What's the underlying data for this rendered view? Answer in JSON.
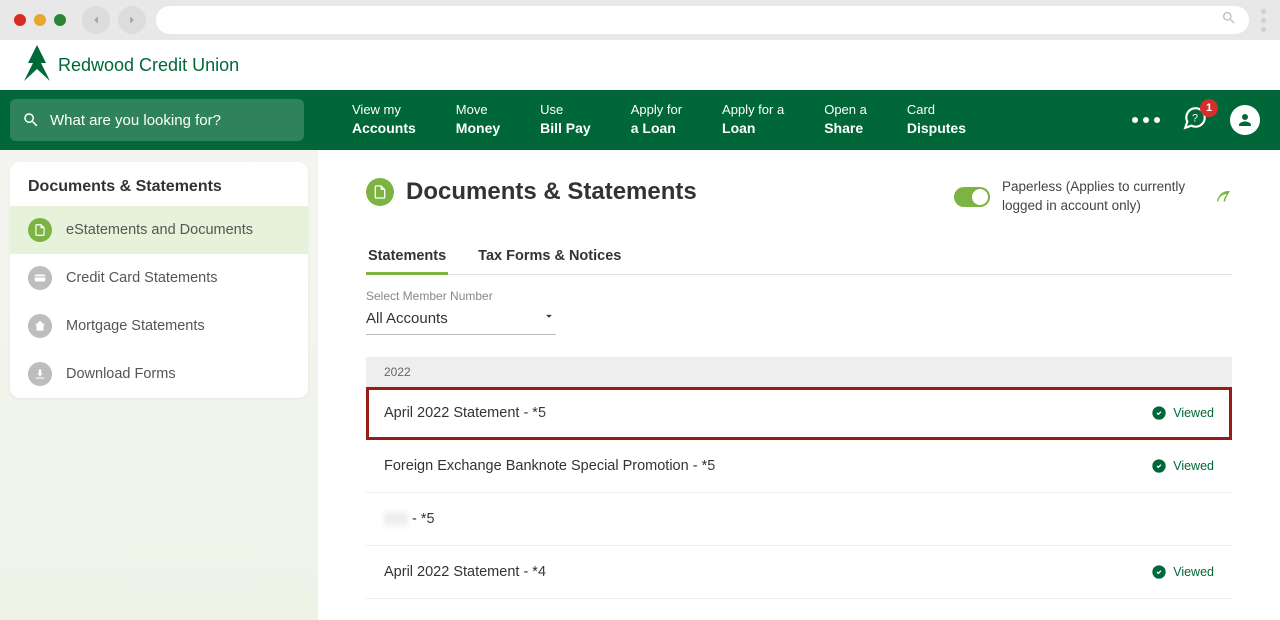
{
  "logo_text": "Redwood Credit Union",
  "search": {
    "placeholder": "What are you looking for?"
  },
  "nav": [
    {
      "small": "View my",
      "big": "Accounts"
    },
    {
      "small": "Move",
      "big": "Money"
    },
    {
      "small": "Use",
      "big": "Bill Pay"
    },
    {
      "small": "Apply for",
      "big": "a Loan"
    },
    {
      "small": "Apply for a",
      "big": "Loan"
    },
    {
      "small": "Open a",
      "big": "Share"
    },
    {
      "small": "Card",
      "big": "Disputes"
    }
  ],
  "notif_count": "1",
  "sidebar": {
    "title": "Documents & Statements",
    "items": [
      {
        "label": "eStatements and Documents"
      },
      {
        "label": "Credit Card Statements"
      },
      {
        "label": "Mortgage Statements"
      },
      {
        "label": "Download Forms"
      }
    ]
  },
  "page": {
    "title": "Documents & Statements",
    "paperless_text": "Paperless (Applies to currently logged in account only)"
  },
  "tabs": [
    {
      "label": "Statements"
    },
    {
      "label": "Tax Forms & Notices"
    }
  ],
  "select": {
    "label": "Select Member Number",
    "value": "All Accounts"
  },
  "year_header": "2022",
  "viewed_label": "Viewed",
  "docs": [
    {
      "title": "April 2022 Statement - *5",
      "viewed": true,
      "highlighted": true
    },
    {
      "title": "Foreign Exchange Banknote Special Promotion - *5",
      "viewed": true
    },
    {
      "title_prefix_redacted": true,
      "title": " - *5",
      "viewed": false
    },
    {
      "title": "April 2022 Statement - *4",
      "viewed": true
    }
  ]
}
